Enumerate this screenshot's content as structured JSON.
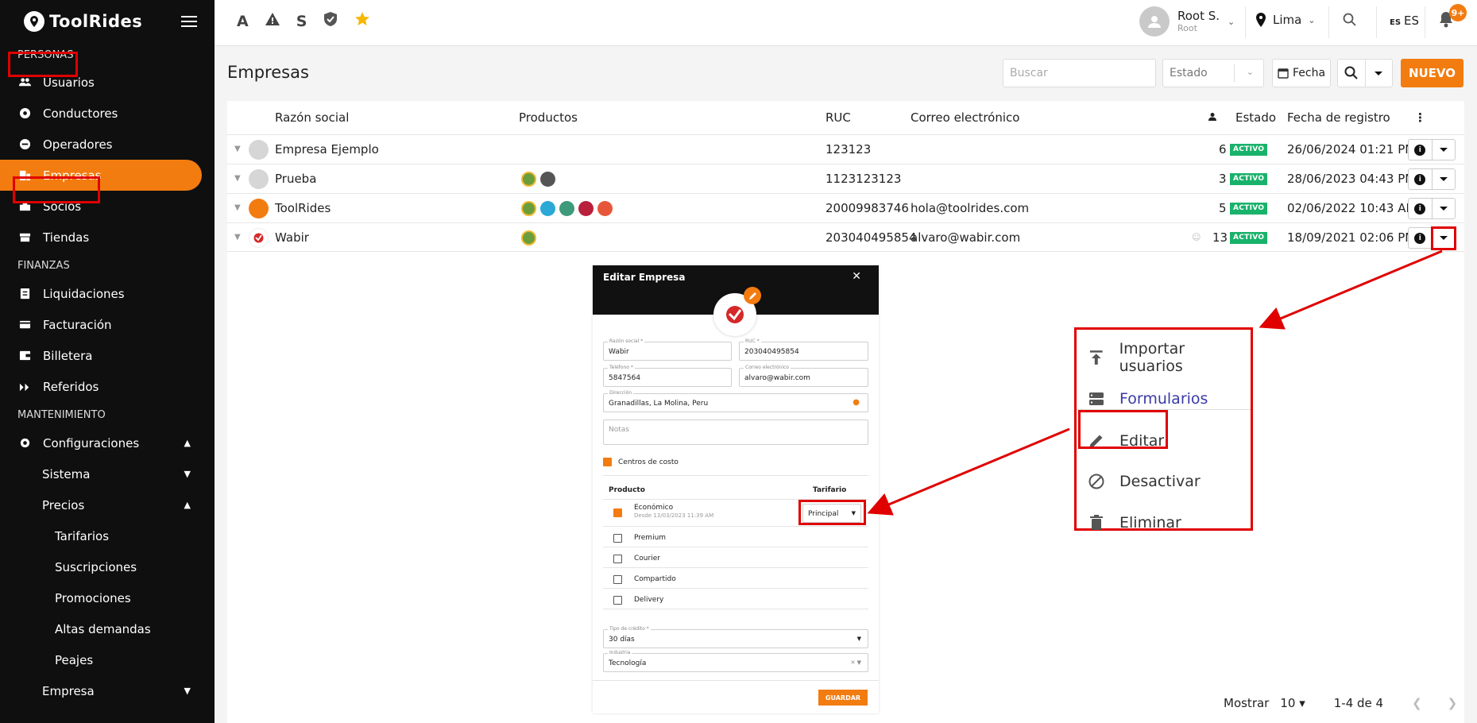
{
  "app": {
    "name": "ToolRides"
  },
  "sidebar": {
    "sections": [
      {
        "label": "PERSONAS",
        "items": [
          {
            "label": "Usuarios"
          },
          {
            "label": "Conductores"
          },
          {
            "label": "Operadores"
          },
          {
            "label": "Empresas",
            "active": true
          },
          {
            "label": "Socios"
          },
          {
            "label": "Tiendas"
          }
        ]
      },
      {
        "label": "FINANZAS",
        "items": [
          {
            "label": "Liquidaciones"
          },
          {
            "label": "Facturación"
          },
          {
            "label": "Billetera"
          },
          {
            "label": "Referidos"
          }
        ]
      },
      {
        "label": "MANTENIMIENTO",
        "items": [
          {
            "label": "Configuraciones"
          },
          {
            "label": "Sistema"
          },
          {
            "label": "Precios"
          },
          {
            "label": "Tarifarios"
          },
          {
            "label": "Suscripciones"
          },
          {
            "label": "Promociones"
          },
          {
            "label": "Altas demandas"
          },
          {
            "label": "Peajes"
          },
          {
            "label": "Empresa"
          }
        ]
      }
    ]
  },
  "topbar": {
    "shortcuts": [
      "A",
      "S"
    ],
    "user": {
      "name": "Root S.",
      "role": "Root"
    },
    "city": "Lima",
    "lang": {
      "flag": "ES",
      "label": "ES"
    },
    "notifications": "9+"
  },
  "page": {
    "title": "Empresas",
    "search_placeholder": "Buscar",
    "estado_placeholder": "Estado",
    "fecha_label": "Fecha",
    "nuevo_label": "NUEVO"
  },
  "table": {
    "headers": {
      "razon": "Razón social",
      "productos": "Productos",
      "ruc": "RUC",
      "correo": "Correo electrónico",
      "estado": "Estado",
      "fecha": "Fecha de registro"
    },
    "rows": [
      {
        "name": "Empresa Ejemplo",
        "ruc": "123123",
        "email": "",
        "count": "6",
        "status": "ACTIVO",
        "date": "26/06/2024 01:21 PM"
      },
      {
        "name": "Prueba",
        "ruc": "1123123123",
        "email": "",
        "count": "3",
        "status": "ACTIVO",
        "date": "28/06/2023 04:43 PM"
      },
      {
        "name": "ToolRides",
        "ruc": "20009983746",
        "email": "hola@toolrides.com",
        "count": "5",
        "status": "ACTIVO",
        "date": "02/06/2022 10:43 AM"
      },
      {
        "name": "Wabir",
        "ruc": "203040495854",
        "email": "alvaro@wabir.com",
        "count": "13",
        "status": "ACTIVO",
        "date": "18/09/2021 02:06 PM"
      }
    ]
  },
  "pagination": {
    "show_label": "Mostrar",
    "per_page": "10",
    "range": "1-4 de 4"
  },
  "modal": {
    "title": "Editar Empresa",
    "fields": {
      "razon_label": "Razón social *",
      "razon_value": "Wabir",
      "ruc_label": "RUC *",
      "ruc_value": "203040495854",
      "tel_label": "Teléfono *",
      "tel_value": "5847564",
      "correo_label": "Correo electrónico",
      "correo_value": "alvaro@wabir.com",
      "dir_label": "Dirección",
      "dir_value": "Granadillas, La Molina, Peru",
      "notas_placeholder": "Notas",
      "centros": "Centros de costo",
      "credito_label": "Tipo de crédito *",
      "credito_value": "30 días",
      "industria_label": "Industria",
      "industria_value": "Tecnología"
    },
    "products_header": {
      "producto": "Producto",
      "tarifario": "Tarifario"
    },
    "products": [
      {
        "name": "Económico",
        "sub": "Desde 13/03/2023 11:39 AM",
        "checked": true,
        "tarifario": "Principal"
      },
      {
        "name": "Premium",
        "checked": false
      },
      {
        "name": "Courier",
        "checked": false
      },
      {
        "name": "Compartido",
        "checked": false
      },
      {
        "name": "Delivery",
        "checked": false
      }
    ],
    "save_label": "GUARDAR"
  },
  "menu": {
    "items": [
      {
        "label": "Importar usuarios",
        "icon": "upload-icon"
      },
      {
        "label": "Formularios",
        "icon": "forms-icon"
      },
      {
        "label": "Editar",
        "icon": "pencil-icon"
      },
      {
        "label": "Desactivar",
        "icon": "block-icon"
      },
      {
        "label": "Eliminar",
        "icon": "trash-icon"
      }
    ]
  },
  "colors": {
    "accent": "#f27c10",
    "status": "#19b26b",
    "highlight": "#e00000",
    "link": "#3a3aa6"
  }
}
